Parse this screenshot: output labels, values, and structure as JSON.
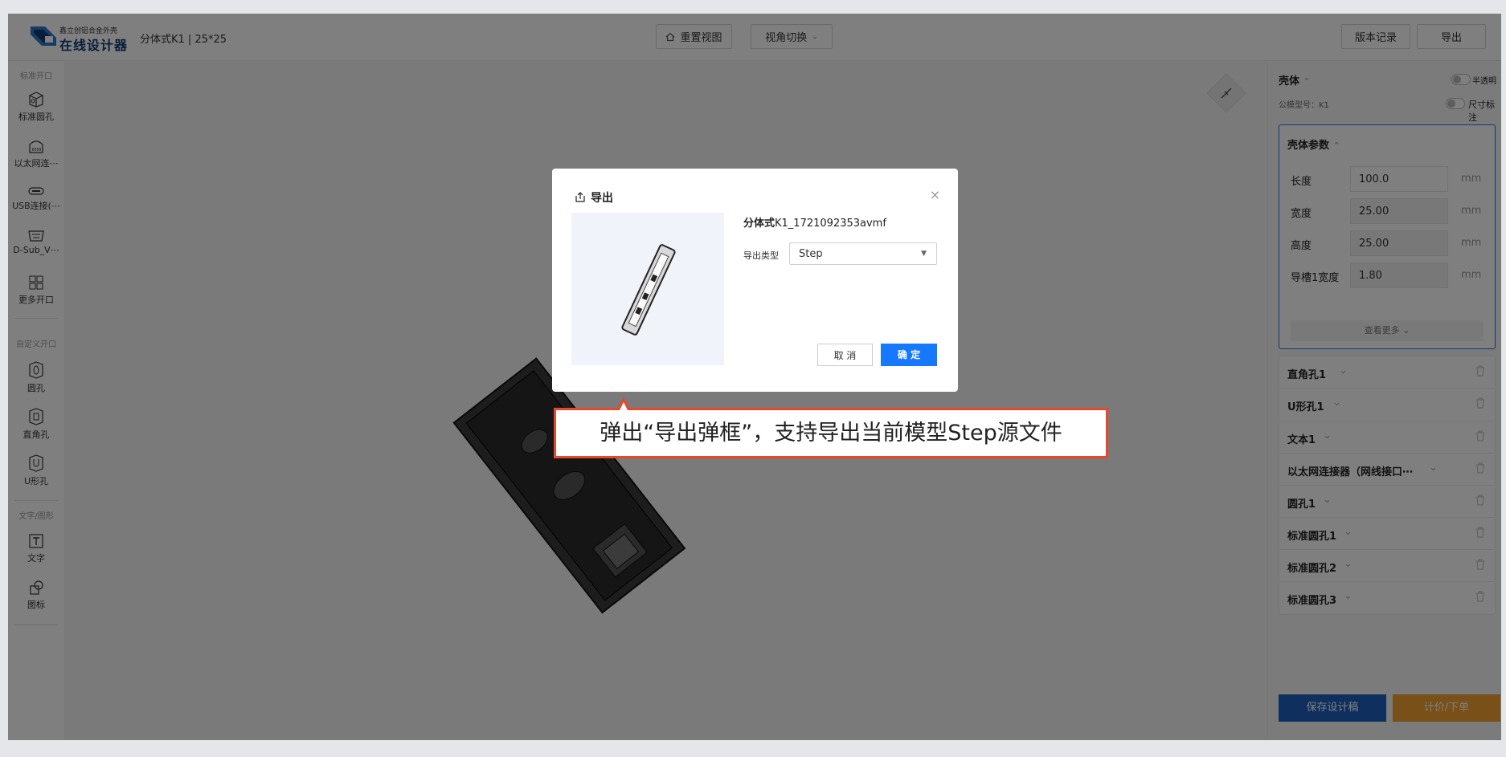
{
  "header": {
    "brand_small": "鑫立创铝合金外壳",
    "brand_big": "在线设计器",
    "project": "分体式K1 | 25*25",
    "reset_view": "重置视图",
    "view_switch": "视角切换",
    "version_history": "版本记录",
    "export": "导出"
  },
  "sidebar": {
    "section1": "标准开口",
    "tools1": [
      "标准圆孔",
      "以太网连⋯",
      "USB连接(⋯",
      "D-Sub_V⋯",
      "更多开口"
    ],
    "section2": "自定义开口",
    "tools2": [
      "圆孔",
      "直角孔",
      "U形孔"
    ],
    "section3": "文字/图形",
    "tools3": [
      "文字",
      "图标"
    ]
  },
  "right_panel": {
    "shell_title": "壳体",
    "translucent_label": "半透明",
    "model_label": "公模型号：K1",
    "dimension_label": "尺寸标注",
    "params_title": "壳体参数",
    "params": [
      {
        "label": "长度",
        "value": "100.0",
        "unit": "mm"
      },
      {
        "label": "宽度",
        "value": "25.00",
        "unit": "mm"
      },
      {
        "label": "高度",
        "value": "25.00",
        "unit": "mm"
      },
      {
        "label": "导槽1宽度",
        "value": "1.80",
        "unit": "mm"
      }
    ],
    "see_more": "查看更多",
    "parts": [
      "直角孔1",
      "U形孔1",
      "文本1",
      "以太网连接器（网线接口⋯",
      "圆孔1",
      "标准圆孔1",
      "标准圆孔2",
      "标准圆孔3"
    ],
    "save_button": "保存设计稿",
    "order_button": "计价/下单"
  },
  "modal": {
    "title": "导出",
    "filename_bold": "分体式",
    "filename_rest": "K1_1721092353avmf",
    "type_label": "导出类型",
    "type_value": "Step",
    "cancel": "取 消",
    "confirm": "确 定"
  },
  "callout": {
    "text": "弹出“导出弹框”，支持导出当前模型Step源文件"
  },
  "colors": {
    "primary": "#1677ff",
    "brand": "#0f3b73",
    "accent_orange": "#f0a030",
    "callout_border": "#e8472b"
  }
}
